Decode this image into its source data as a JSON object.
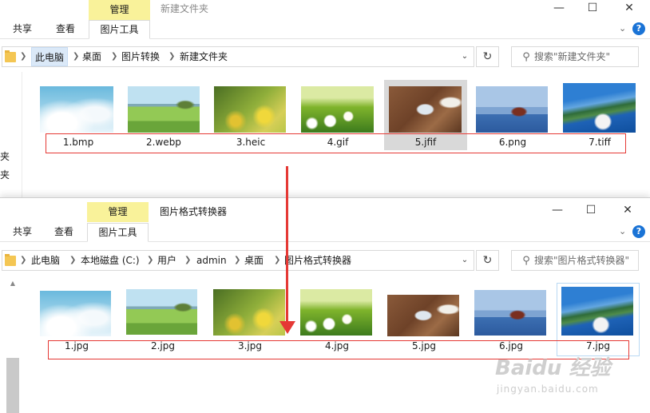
{
  "top_window": {
    "manage_tab": "管理",
    "title": "新建文件夹",
    "ribbon_tabs": [
      "共享",
      "查看",
      "图片工具"
    ],
    "breadcrumb": [
      "此电脑",
      "桌面",
      "图片转换",
      "新建文件夹"
    ],
    "search_placeholder": "搜索\"新建文件夹\"",
    "nav_fragments": [
      "夹",
      "夹"
    ],
    "files": [
      {
        "name": "1.bmp"
      },
      {
        "name": "2.webp"
      },
      {
        "name": "3.heic"
      },
      {
        "name": "4.gif"
      },
      {
        "name": "5.jfif"
      },
      {
        "name": "6.png"
      },
      {
        "name": "7.tiff"
      }
    ]
  },
  "bottom_window": {
    "manage_tab": "管理",
    "title": "图片格式转换器",
    "ribbon_tabs": [
      "共享",
      "查看",
      "图片工具"
    ],
    "breadcrumb": [
      "此电脑",
      "本地磁盘 (C:)",
      "用户",
      "admin",
      "桌面",
      "图片格式转换器"
    ],
    "search_placeholder": "搜索\"图片格式转换器\"",
    "files": [
      {
        "name": "1.jpg"
      },
      {
        "name": "2.jpg"
      },
      {
        "name": "3.jpg"
      },
      {
        "name": "4.jpg"
      },
      {
        "name": "5.jpg"
      },
      {
        "name": "6.jpg"
      },
      {
        "name": "7.jpg"
      }
    ]
  },
  "watermark": {
    "brand": "Baidu 经验",
    "url": "jingyan.baidu.com"
  },
  "colors": {
    "manage_tab": "#f9f29a",
    "highlight_box": "#e53935",
    "help": "#1a73d6",
    "selected_crumb": "#dbe9f8"
  }
}
